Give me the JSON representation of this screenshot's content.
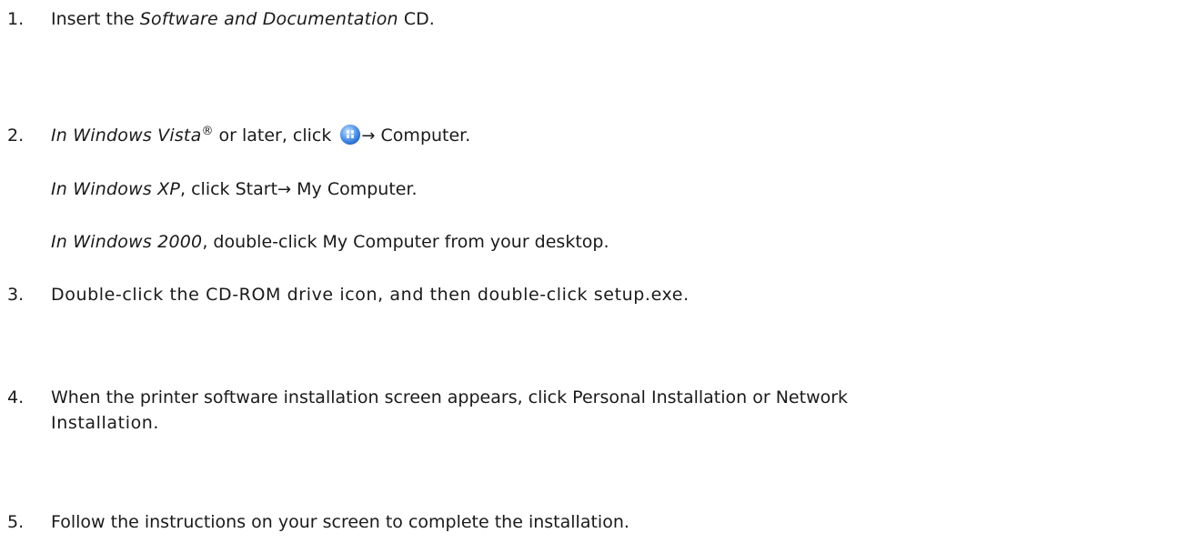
{
  "steps": [
    {
      "number": "1.",
      "prefix": "Insert the ",
      "italic": "Software and Documentation",
      "suffix": " CD."
    },
    {
      "number": "2.",
      "italic": "In Windows Vista",
      "registered": "®",
      "mid": " or later, click ",
      "arrow": "→",
      "target": " Computer."
    },
    {
      "number": "3.",
      "text": "Double-click the CD-ROM drive icon, and then double-click setup.exe."
    },
    {
      "number": "4.",
      "line1": "When the printer software installation screen appears, click Personal Installation or Network",
      "line2": "Installation."
    },
    {
      "number": "5.",
      "text": "Follow the instructions on your screen to complete the installation."
    }
  ],
  "substeps": {
    "xp": {
      "italic": "In Windows XP",
      "text1": ", click Start",
      "arrow": "→",
      "text2": " My Computer."
    },
    "w2000": {
      "italic": "In Windows 2000",
      "text": ", double-click My Computer from your desktop."
    }
  },
  "icons": {
    "start": "windows-start-orb-icon"
  }
}
